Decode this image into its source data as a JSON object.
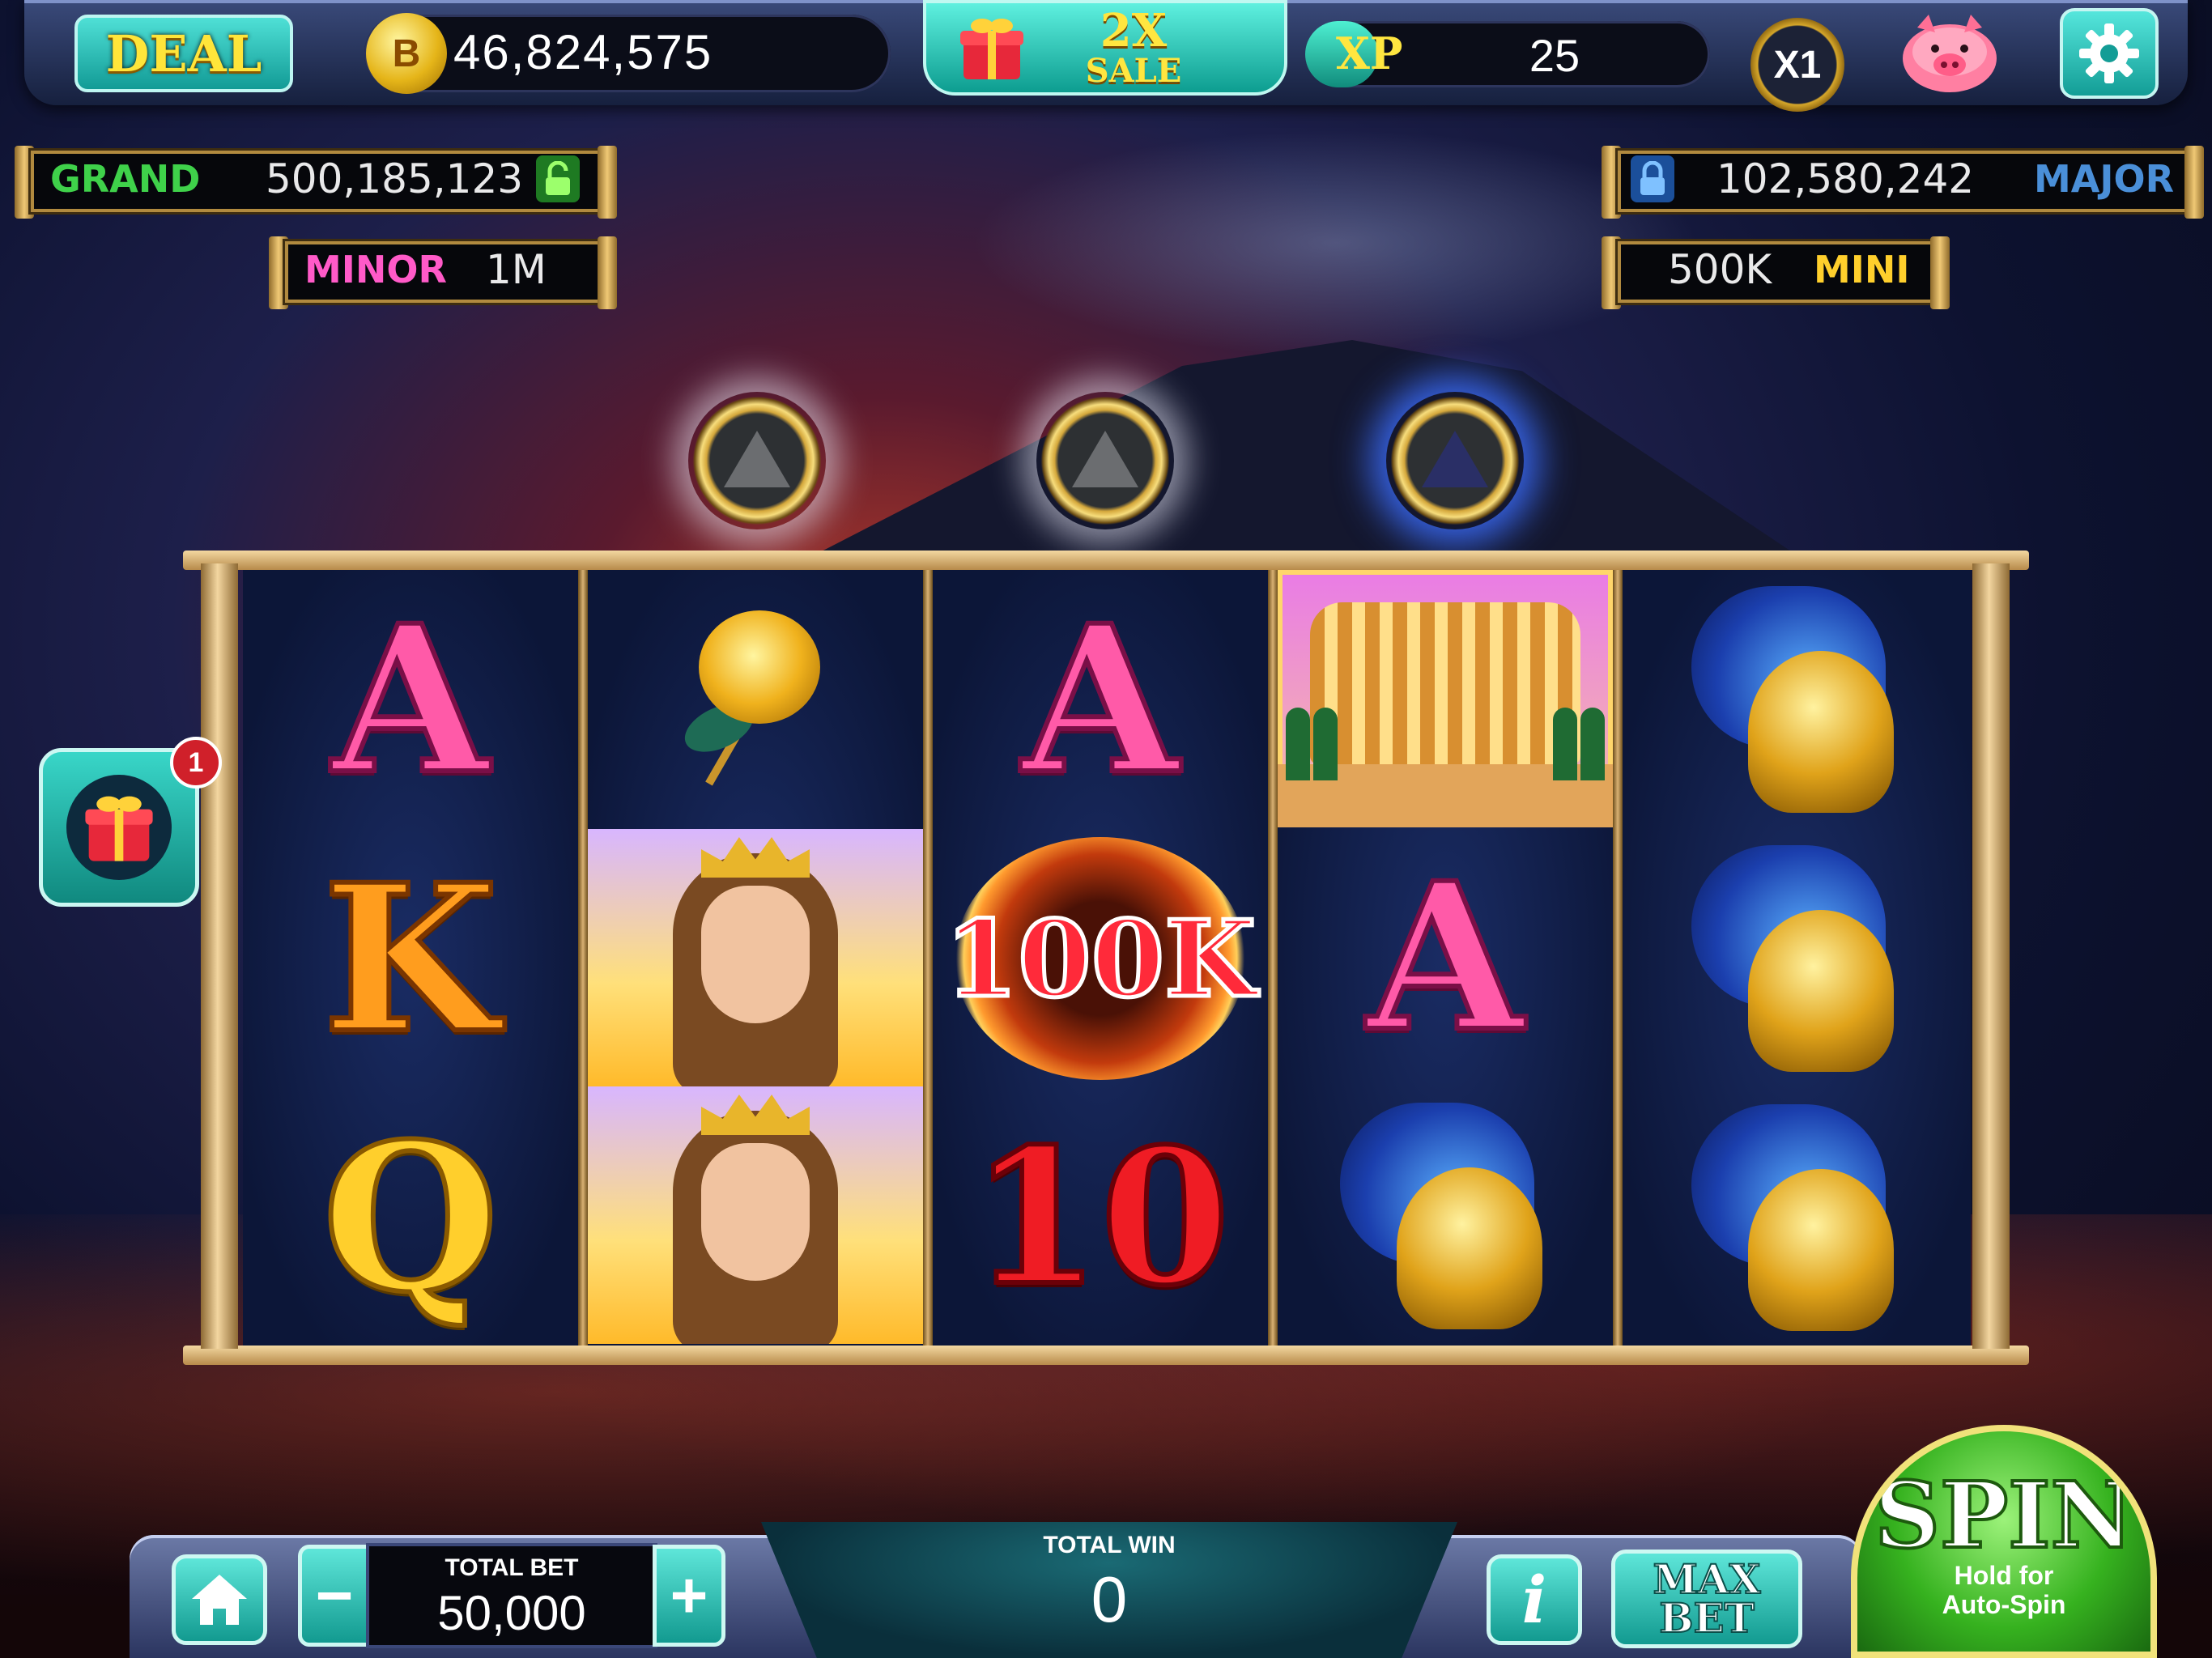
{
  "topbar": {
    "deal_label": "DEAL",
    "coin_icon_letter": "B",
    "coin_balance": "46,824,575",
    "sale_multiplier": "2X",
    "sale_label": "SALE",
    "xp_label": "XP",
    "xp_value": "25",
    "xp_progress_percent": 18,
    "multiplier": "X1",
    "icons": [
      "coin-icon",
      "gift-icon",
      "piggy-bank-icon",
      "gear-icon"
    ]
  },
  "jackpots": {
    "grand": {
      "name": "GRAND",
      "value": "500,185,123",
      "locked": false
    },
    "major": {
      "name": "MAJOR",
      "value": "102,580,242",
      "locked": true
    },
    "minor": {
      "name": "MINOR",
      "value": "1M"
    },
    "mini": {
      "name": "MINI",
      "value": "500K"
    }
  },
  "bonus_orbs": [
    "volcano-orb-grey",
    "volcano-orb-grey",
    "volcano-orb-blue"
  ],
  "reels": [
    [
      "A",
      "K",
      "Q"
    ],
    [
      "golden-rose",
      "queen",
      "queen"
    ],
    [
      "A",
      "100K",
      "10"
    ],
    [
      "colosseum",
      "A",
      "spartan-helmet"
    ],
    [
      "spartan-helmet",
      "spartan-helmet",
      "spartan-helmet"
    ]
  ],
  "symbols": {
    "r1_top": "A",
    "r1_mid": "K",
    "r1_bot": "Q",
    "r3_top": "A",
    "r3_mid": "100K",
    "r3_bot": "10",
    "r4_mid": "A"
  },
  "side_gift": {
    "badge_count": "1"
  },
  "bottombar": {
    "total_bet_label": "TOTAL BET",
    "total_bet_value": "50,000",
    "minus": "−",
    "plus": "+",
    "total_win_label": "TOTAL WIN",
    "total_win_value": "0",
    "info_label": "i",
    "max_bet_line1": "MAX",
    "max_bet_line2": "BET",
    "spin_label": "SPIN",
    "spin_sub1": "Hold for",
    "spin_sub2": "Auto-Spin"
  },
  "colors": {
    "accent_teal": "#1ab0a6",
    "gold": "#d6a72a",
    "grand": "#3fd14a",
    "major": "#4a8fd8",
    "minor": "#ff5ac8",
    "mini": "#ffcf2c"
  }
}
